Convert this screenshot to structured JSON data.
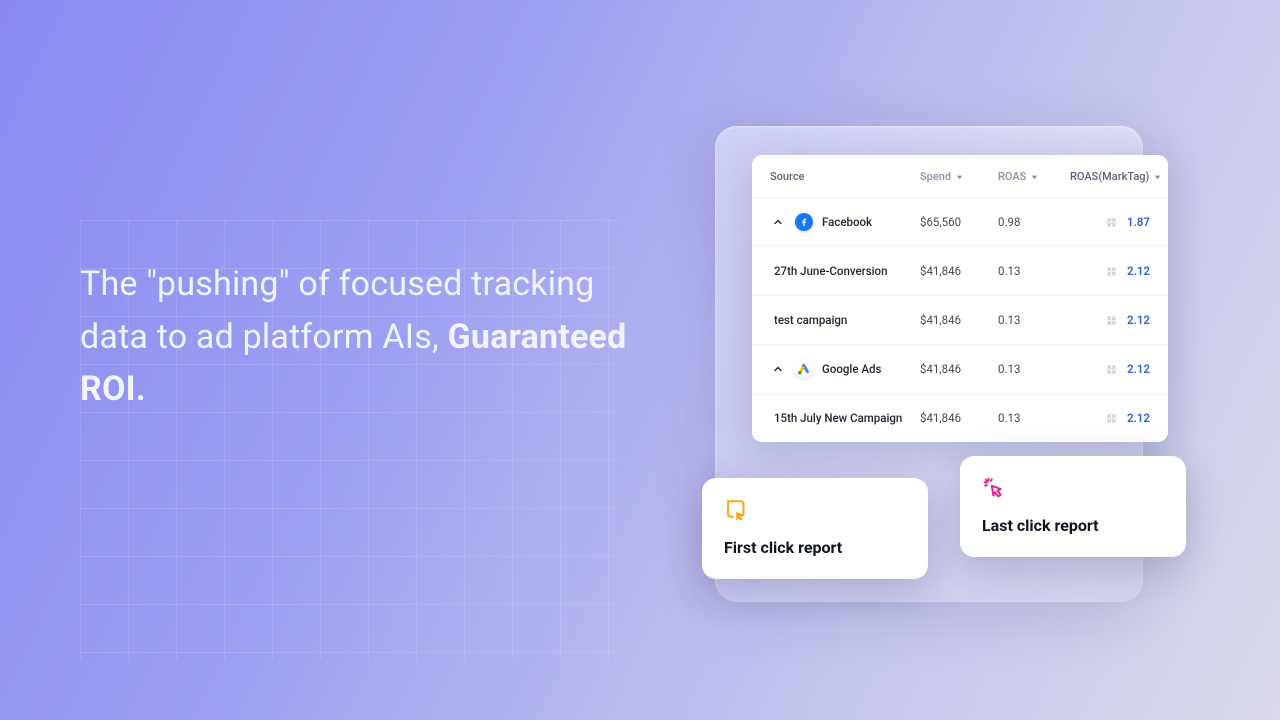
{
  "headline": {
    "part1": "The \"pushing\" of focused tracking data to ad platform AIs, ",
    "bold": "Guaranteed ROI."
  },
  "table": {
    "headers": {
      "source": "Source",
      "spend": "Spend",
      "roas": "ROAS",
      "roas_mark": "ROAS(MarkTag)"
    },
    "rows": [
      {
        "type": "group",
        "platform": "facebook",
        "name": "Facebook",
        "spend": "$65,560",
        "roas": "0.98",
        "mark": "1.87"
      },
      {
        "type": "item",
        "name": "27th June-Conversion",
        "spend": "$41,846",
        "roas": "0.13",
        "mark": "2.12"
      },
      {
        "type": "item",
        "name": "test campaign",
        "spend": "$41,846",
        "roas": "0.13",
        "mark": "2.12"
      },
      {
        "type": "group",
        "platform": "google",
        "name": "Google Ads",
        "spend": "$41,846",
        "roas": "0.13",
        "mark": "2.12"
      },
      {
        "type": "item",
        "name": "15th July New Campaign",
        "spend": "$41,846",
        "roas": "0.13",
        "mark": "2.12"
      }
    ]
  },
  "cards": {
    "first": "First click report",
    "last": "Last click report"
  },
  "colors": {
    "link": "#2a62d6",
    "accent_yellow": "#f4a824",
    "accent_pink": "#e1218a"
  }
}
